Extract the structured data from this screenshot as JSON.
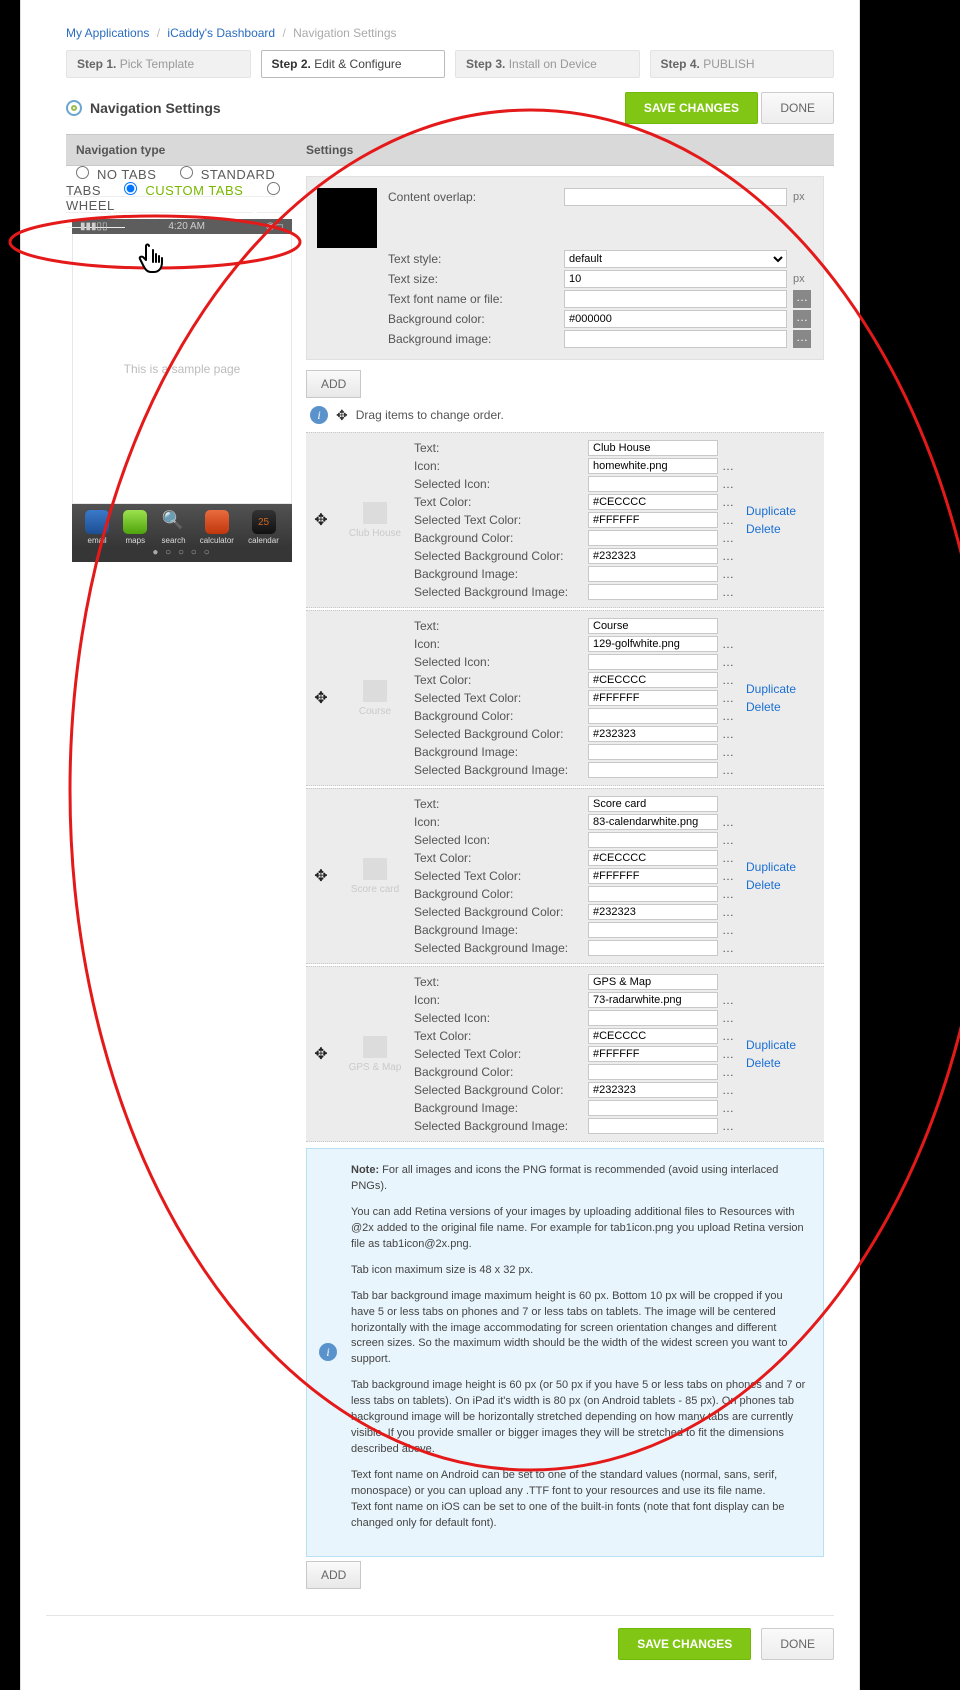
{
  "breadcrumb": {
    "a": "My Applications",
    "b": "iCaddy's Dashboard",
    "c": "Navigation Settings"
  },
  "steps": [
    {
      "bold": "Step 1.",
      "label": " Pick Template"
    },
    {
      "bold": "Step 2.",
      "label": " Edit & Configure"
    },
    {
      "bold": "Step 3.",
      "label": " Install on Device"
    },
    {
      "bold": "Step 4.",
      "label": " PUBLISH"
    }
  ],
  "title": "Navigation Settings",
  "buttons": {
    "save": "SAVE CHANGES",
    "done": "DONE",
    "add": "ADD"
  },
  "headers": {
    "navtype": "Navigation type",
    "settings": "Settings"
  },
  "navtype": {
    "notabs": "NO TABS",
    "std": "STANDARD TABS",
    "custom": "CUSTOM TABS",
    "wheel": "WHEEL"
  },
  "phone": {
    "time": "4:20 AM",
    "sample": "This is a sample page",
    "tabs": [
      "email",
      "maps",
      "search",
      "calculator",
      "calendar"
    ],
    "cal": "25"
  },
  "gs": {
    "overlap": {
      "lbl": "Content overlap:",
      "val": "",
      "unit": "px"
    },
    "style": {
      "lbl": "Text style:",
      "val": "default"
    },
    "size": {
      "lbl": "Text size:",
      "val": "10",
      "unit": "px"
    },
    "font": {
      "lbl": "Text font name or file:",
      "val": ""
    },
    "bgc": {
      "lbl": "Background color:",
      "val": "#000000"
    },
    "bgi": {
      "lbl": "Background image:",
      "val": ""
    }
  },
  "drag_hint": "Drag items to change order.",
  "field_labels": {
    "text": "Text:",
    "icon": "Icon:",
    "sicon": "Selected Icon:",
    "tc": "Text Color:",
    "stc": "Selected Text Color:",
    "bc": "Background Color:",
    "sbc": "Selected Background Color:",
    "bi": "Background Image:",
    "sbi": "Selected Background Image:"
  },
  "actions": {
    "dup": "Duplicate",
    "del": "Delete"
  },
  "tabs": [
    {
      "label": "Club House",
      "text": "Club House",
      "icon": "homewhite.png",
      "sicon": "",
      "tc": "#CECCCC",
      "stc": "#FFFFFF",
      "bc": "",
      "sbc": "#232323",
      "bi": "",
      "sbi": ""
    },
    {
      "label": "Course",
      "text": "Course",
      "icon": "129-golfwhite.png",
      "sicon": "",
      "tc": "#CECCCC",
      "stc": "#FFFFFF",
      "bc": "",
      "sbc": "#232323",
      "bi": "",
      "sbi": ""
    },
    {
      "label": "Score card",
      "text": "Score card",
      "icon": "83-calendarwhite.png",
      "sicon": "",
      "tc": "#CECCCC",
      "stc": "#FFFFFF",
      "bc": "",
      "sbc": "#232323",
      "bi": "",
      "sbi": ""
    },
    {
      "label": "GPS & Map",
      "text": "GPS & Map",
      "icon": "73-radarwhite.png",
      "sicon": "",
      "tc": "#CECCCC",
      "stc": "#FFFFFF",
      "bc": "",
      "sbc": "#232323",
      "bi": "",
      "sbi": ""
    }
  ],
  "note": {
    "p1a": "Note:",
    "p1b": " For all images and icons the PNG format is recommended (avoid using interlaced PNGs).",
    "p2": "You can add Retina versions of your images by uploading additional files to Resources with @2x added to the original file name. For example for tab1icon.png you upload Retina version file as tab1icon@2x.png.",
    "p3": "Tab icon maximum size is 48 x 32 px.",
    "p4": "Tab bar background image maximum height is 60 px. Bottom 10 px will be cropped if you have 5 or less tabs on phones and 7 or less tabs on tablets. The image will be centered horizontally with the image accommodating for screen orientation changes and different screen sizes. So the maximum width should be the width of the widest screen you want to support.",
    "p5": "Tab background image height is 60 px (or 50 px if you have 5 or less tabs on phones and 7 or less tabs on tablets). On iPad it's width is 80 px (on Android tablets - 85 px). On phones tab background image will be horizontally stretched depending on how many tabs are currently visible. If you provide smaller or bigger images they will be stretched to fit the dimensions described above.",
    "p6": "Text font name on Android can be set to one of the standard values (normal, sans, serif, monospace) or you can upload any .TTF font to your resources and use its file name.",
    "p7": "Text font name on iOS can be set to one of the built-in fonts (note that font display can be changed only for default font)."
  }
}
